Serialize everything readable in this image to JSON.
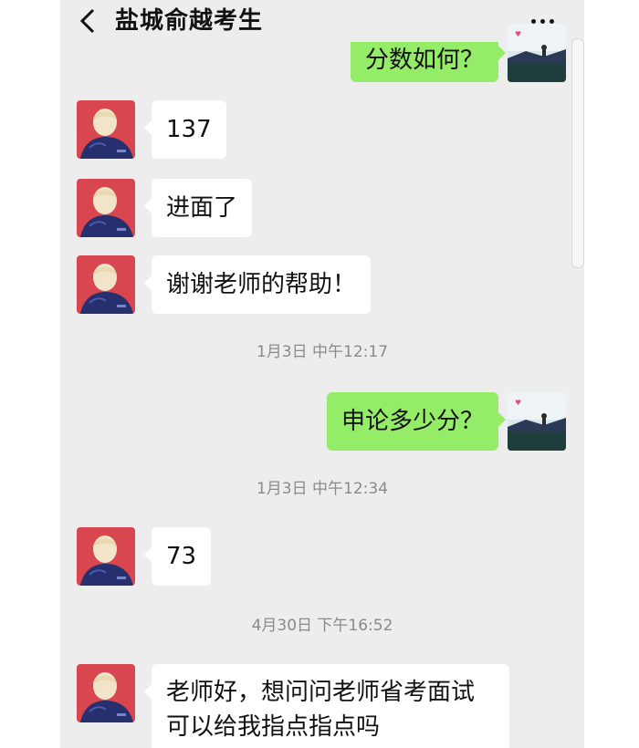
{
  "header": {
    "title": "盐城俞越考生"
  },
  "messages": {
    "top_partial": "分数如何？",
    "m1": "137",
    "m2": "进面了",
    "m3": "谢谢老师的帮助！",
    "ts1": "1月3日 中午12:17",
    "m4": "申论多少分？",
    "ts2": "1月3日 中午12:34",
    "m5": "73",
    "ts3": "4月30日 下午16:52",
    "m6_line1": "老师好，想问问老师省考面试",
    "m6_line2": "可以给我指点指点吗"
  },
  "colors": {
    "background": "#ededed",
    "right_bubble": "#95ec69",
    "left_bubble": "#ffffff"
  }
}
